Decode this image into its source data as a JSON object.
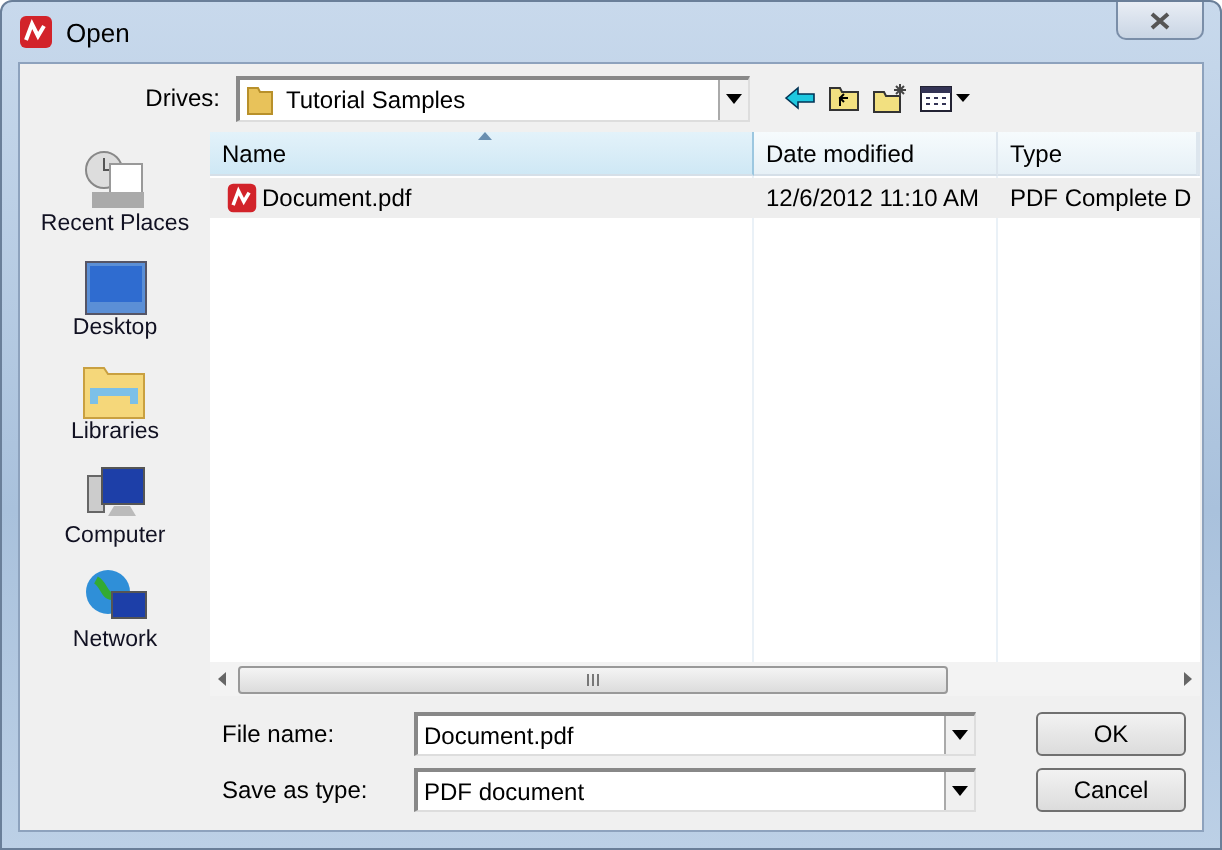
{
  "window": {
    "title": "Open"
  },
  "drives": {
    "label": "Drives:",
    "value": "Tutorial Samples"
  },
  "places": [
    {
      "label": "Recent Places",
      "kind": "recent"
    },
    {
      "label": "Desktop",
      "kind": "desktop"
    },
    {
      "label": "Libraries",
      "kind": "libraries"
    },
    {
      "label": "Computer",
      "kind": "computer"
    },
    {
      "label": "Network",
      "kind": "network"
    }
  ],
  "table": {
    "columns": [
      "Name",
      "Date modified",
      "Type"
    ],
    "rows": [
      {
        "name": "Document.pdf",
        "date": "12/6/2012 11:10 AM",
        "type": "PDF Complete D",
        "selected": true
      }
    ]
  },
  "file_name": {
    "label": "File name:",
    "value": "Document.pdf"
  },
  "save_as_type": {
    "label": "Save as type:",
    "value": "PDF document"
  },
  "buttons": [
    "OK",
    "Cancel"
  ]
}
